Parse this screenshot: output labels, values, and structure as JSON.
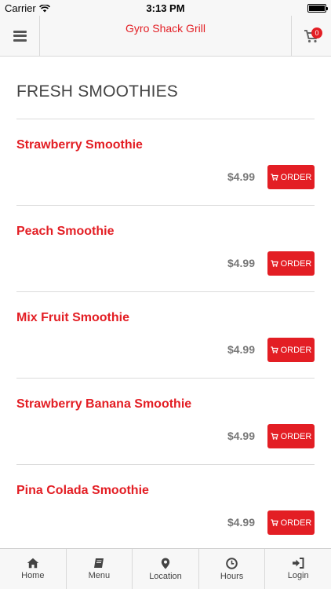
{
  "status_bar": {
    "carrier": "Carrier",
    "time": "3:13 PM"
  },
  "nav": {
    "title": "Gyro Shack Grill",
    "cart_count": "0"
  },
  "section": {
    "title": "FRESH SMOOTHIES"
  },
  "items": [
    {
      "name": "Strawberry Smoothie",
      "price": "$4.99",
      "button_label": "ORDER"
    },
    {
      "name": "Peach Smoothie",
      "price": "$4.99",
      "button_label": "ORDER"
    },
    {
      "name": "Mix Fruit Smoothie",
      "price": "$4.99",
      "button_label": "ORDER"
    },
    {
      "name": "Strawberry Banana Smoothie",
      "price": "$4.99",
      "button_label": "ORDER"
    },
    {
      "name": "Pina Colada Smoothie",
      "price": "$4.99",
      "button_label": "ORDER"
    }
  ],
  "tabs": [
    {
      "label": "Home",
      "icon": "home-icon"
    },
    {
      "label": "Menu",
      "icon": "book-icon"
    },
    {
      "label": "Location",
      "icon": "map-pin-icon"
    },
    {
      "label": "Hours",
      "icon": "clock-icon"
    },
    {
      "label": "Login",
      "icon": "sign-in-icon"
    }
  ],
  "colors": {
    "accent": "#e31e24",
    "bar_background": "#f7f7f7",
    "price": "#777777"
  }
}
